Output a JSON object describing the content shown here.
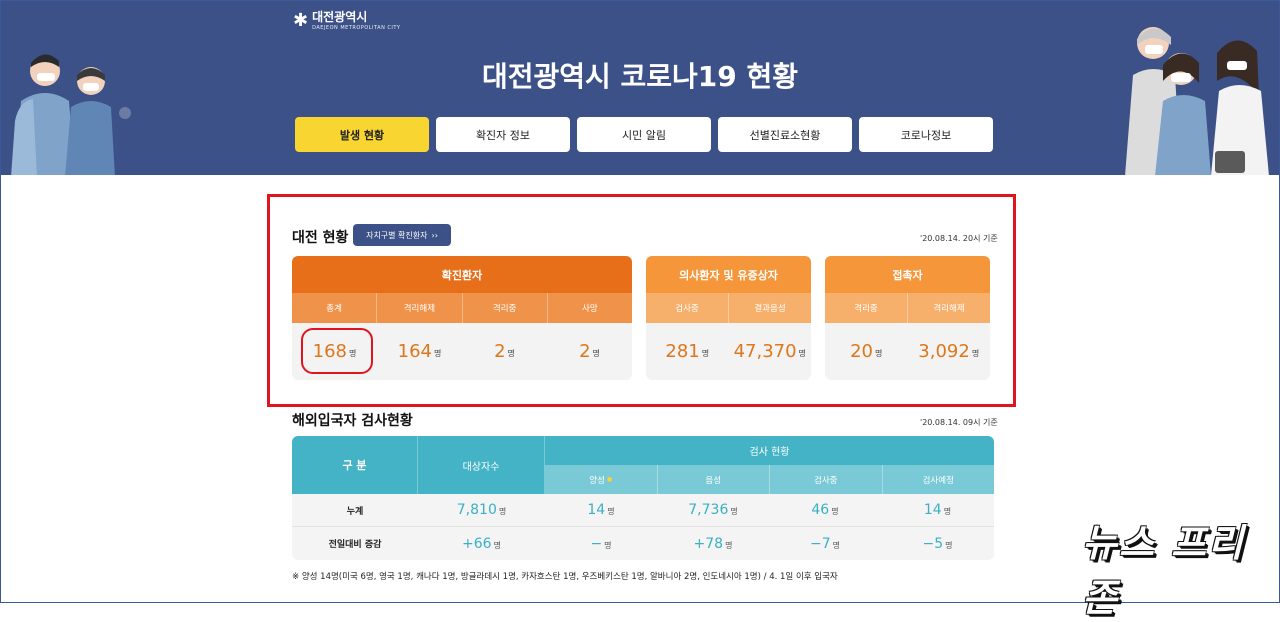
{
  "header": {
    "logo_name": "대전광역시",
    "logo_sub": "DAEJEON METROPOLITAN CITY",
    "title": "대전광역시 코로나19 현황",
    "tabs": [
      {
        "label": "발생 현황",
        "active": true
      },
      {
        "label": "확진자 정보"
      },
      {
        "label": "시민 알림"
      },
      {
        "label": "선별진료소현황"
      },
      {
        "label": "코로나정보"
      }
    ]
  },
  "status": {
    "title": "대전 현황",
    "district_button": "자치구별 확진환자",
    "timestamp": "'20.08.14. 20시 기준",
    "confirmed": {
      "title": "확진환자",
      "columns": [
        "총계",
        "격리해제",
        "격리중",
        "사망"
      ],
      "values": [
        "168",
        "164",
        "2",
        "2"
      ]
    },
    "suspected": {
      "title": "의사환자 및 유증상자",
      "columns": [
        "검사중",
        "결과음성"
      ],
      "values": [
        "281",
        "47,370"
      ]
    },
    "contacts": {
      "title": "접촉자",
      "columns": [
        "격리중",
        "격리해제"
      ],
      "values": [
        "20",
        "3,092"
      ]
    },
    "unit": "명"
  },
  "overseas": {
    "title": "해외입국자 검사현황",
    "timestamp": "'20.08.14. 09시 기준",
    "header_category": "구 분",
    "header_target": "대상자수",
    "header_test": "검사 현황",
    "sub_headers": [
      "양성",
      "음성",
      "검사중",
      "검사예정"
    ],
    "positive_mark": "●",
    "rows": [
      {
        "label": "누계",
        "target": "7,810",
        "values": [
          "14",
          "7,736",
          "46",
          "14"
        ]
      },
      {
        "label": "전일대비 증감",
        "target": "+66",
        "values": [
          "−",
          "+78",
          "−7",
          "−5"
        ]
      }
    ],
    "footnote": "※ 양성 14명(미국 6명, 영국 1명, 캐나다 1명, 방글라데시 1명, 카자흐스탄 1명, 우즈베키스탄 1명, 알바니아 2명, 인도네시아 1명) / 4. 1일 이후 입국자"
  },
  "watermark": "뉴스 프리존",
  "colors": {
    "header_bg": "#3c5187",
    "active_tab": "#f8d531",
    "confirmed_header": "#e86f1a",
    "confirmed_sub": "#f0934a",
    "suspected_header": "#f5963a",
    "suspected_sub": "#f7b06c",
    "table_teal": "#44b3c6",
    "highlight_red": "#e0141e"
  }
}
